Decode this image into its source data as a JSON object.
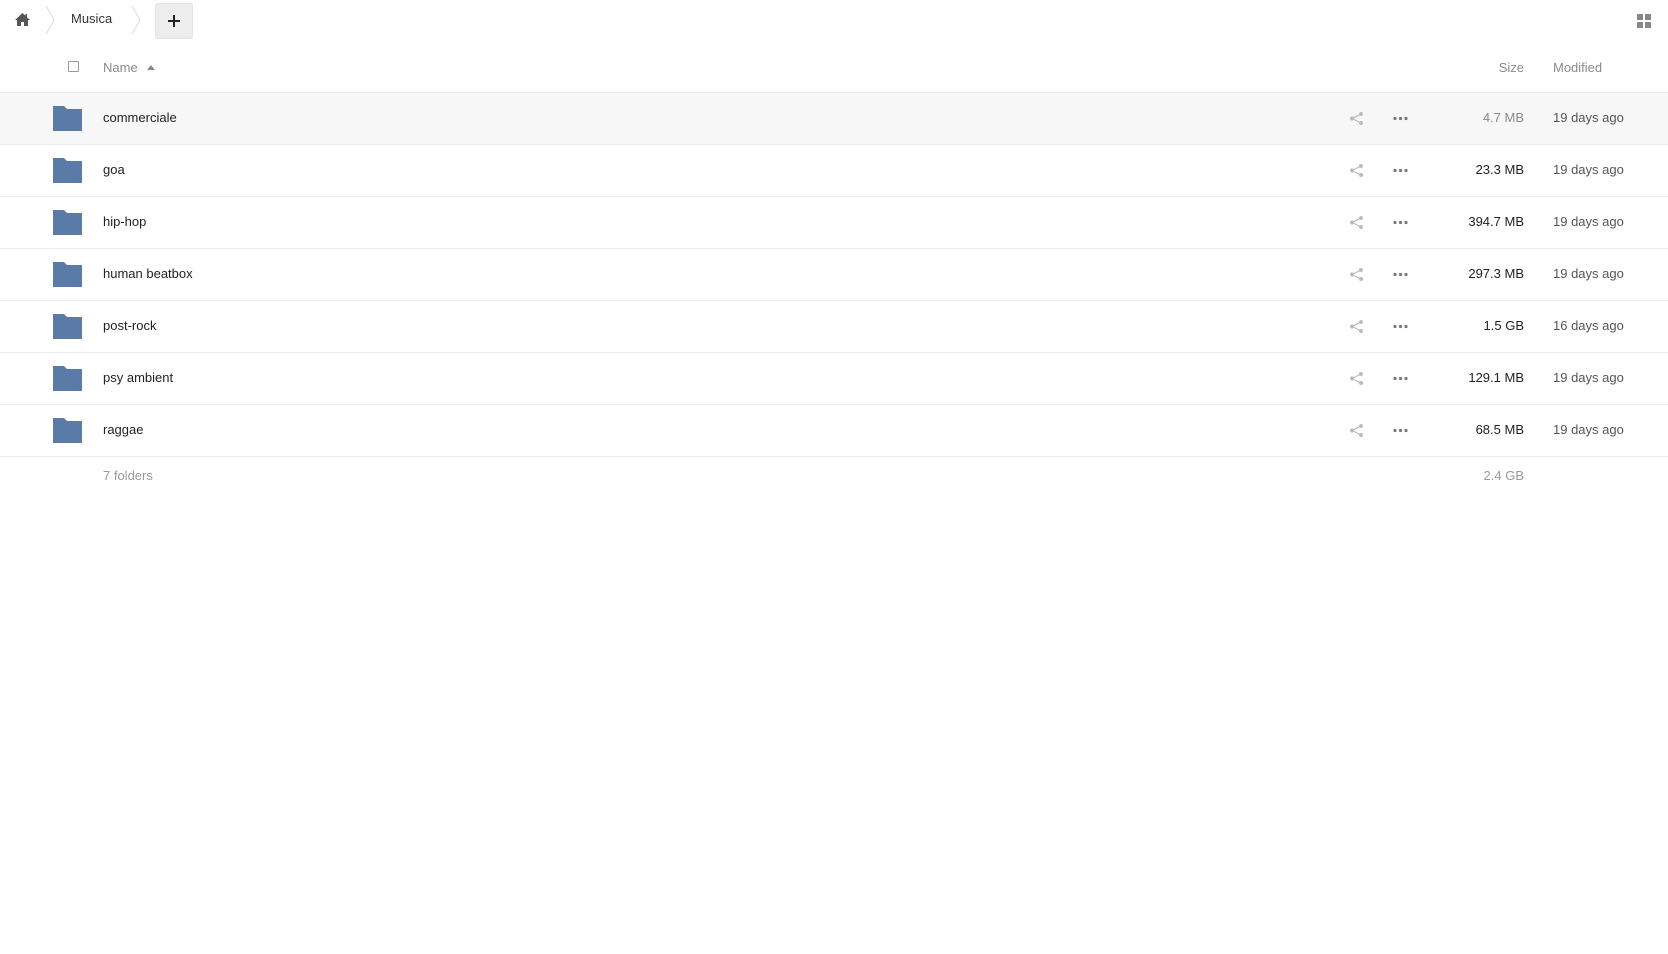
{
  "breadcrumb": {
    "home_icon": "home-icon",
    "current": "Musica"
  },
  "toolbar": {
    "new_label": "+",
    "view_icon": "grid-view-icon"
  },
  "table": {
    "columns": {
      "name": "Name",
      "size": "Size",
      "modified": "Modified"
    },
    "sort_icon": "sort-ascending-icon",
    "folder_color": "#5a7aa7",
    "rows": [
      {
        "name": "commerciale",
        "size": "4.7 MB",
        "modified": "19 days ago"
      },
      {
        "name": "goa",
        "size": "23.3 MB",
        "modified": "19 days ago"
      },
      {
        "name": "hip-hop",
        "size": "394.7 MB",
        "modified": "19 days ago"
      },
      {
        "name": "human beatbox",
        "size": "297.3 MB",
        "modified": "19 days ago"
      },
      {
        "name": "post-rock",
        "size": "1.5 GB",
        "modified": "16 days ago"
      },
      {
        "name": "psy ambient",
        "size": "129.1 MB",
        "modified": "19 days ago"
      },
      {
        "name": "raggae",
        "size": "68.5 MB",
        "modified": "19 days ago"
      }
    ]
  },
  "summary": {
    "count": "7 folders",
    "total_size": "2.4 GB"
  }
}
